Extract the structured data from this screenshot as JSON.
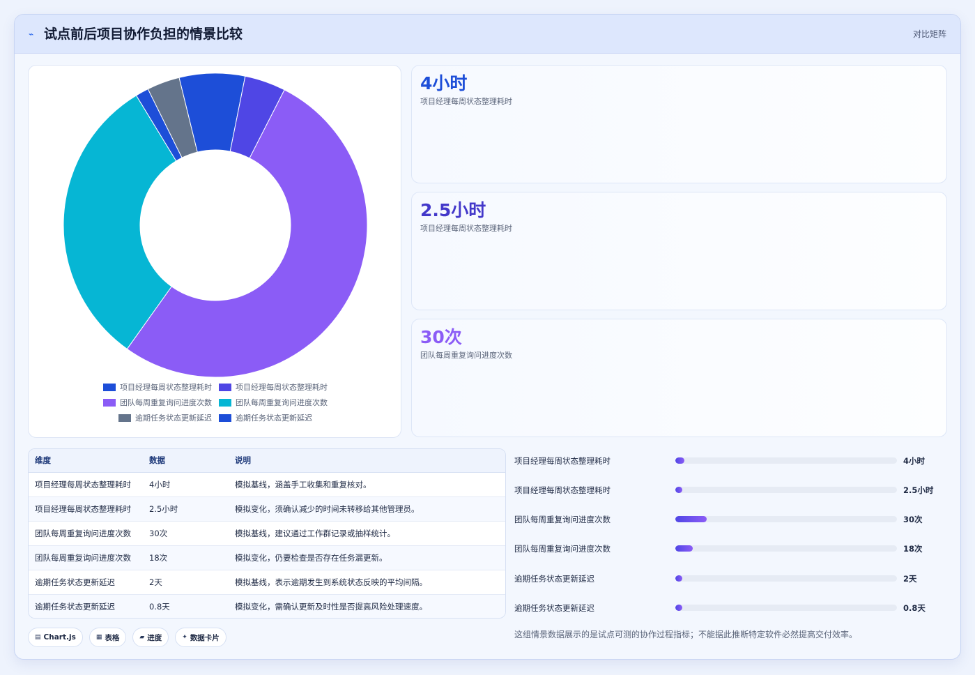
{
  "header": {
    "icon": "sparkline-icon",
    "title": "试点前后项目协作负担的情景比较",
    "mode_label": "对比矩阵"
  },
  "chart_data": {
    "type": "pie",
    "donut": true,
    "labels": [
      "项目经理每周状态整理耗时",
      "项目经理每周状态整理耗时",
      "团队每周重复询问进度次数",
      "团队每周重复询问进度次数",
      "逾期任务状态更新延迟",
      "逾期任务状态更新延迟"
    ],
    "values": [
      4,
      2.5,
      30,
      18,
      2,
      0.8
    ],
    "colors": [
      "#1d4ed8",
      "#4f46e5",
      "#8b5cf6",
      "#06b6d4",
      "#64748b",
      "#1d4ed8"
    ],
    "legend_position": "bottom"
  },
  "kpis": [
    {
      "value": "4小时",
      "label": "项目经理每周状态整理耗时",
      "color": "#1d4ed8"
    },
    {
      "value": "2.5小时",
      "label": "项目经理每周状态整理耗时",
      "color": "#4338ca"
    },
    {
      "value": "30次",
      "label": "团队每周重复询问进度次数",
      "color": "#8b5cf6"
    }
  ],
  "table": {
    "headers": [
      "维度",
      "数据",
      "说明"
    ],
    "rows": [
      [
        "项目经理每周状态整理耗时",
        "4小时",
        "模拟基线，涵盖手工收集和重复核对。"
      ],
      [
        "项目经理每周状态整理耗时",
        "2.5小时",
        "模拟变化，须确认减少的时间未转移给其他管理员。"
      ],
      [
        "团队每周重复询问进度次数",
        "30次",
        "模拟基线，建议通过工作群记录或抽样统计。"
      ],
      [
        "团队每周重复询问进度次数",
        "18次",
        "模拟变化，仍要检查是否存在任务漏更新。"
      ],
      [
        "逾期任务状态更新延迟",
        "2天",
        "模拟基线，表示逾期发生到系统状态反映的平均间隔。"
      ],
      [
        "逾期任务状态更新延迟",
        "0.8天",
        "模拟变化，需确认更新及时性是否提高风险处理速度。"
      ]
    ]
  },
  "progress": [
    {
      "label": "项目经理每周状态整理耗时",
      "value": "4小时",
      "fraction": 0.04
    },
    {
      "label": "项目经理每周状态整理耗时",
      "value": "2.5小时",
      "fraction": 0.025
    },
    {
      "label": "团队每周重复询问进度次数",
      "value": "30次",
      "fraction": 0.14
    },
    {
      "label": "团队每周重复询问进度次数",
      "value": "18次",
      "fraction": 0.08
    },
    {
      "label": "逾期任务状态更新延迟",
      "value": "2天",
      "fraction": 0.02
    },
    {
      "label": "逾期任务状态更新延迟",
      "value": "0.8天",
      "fraction": 0.008
    }
  ],
  "chips": [
    {
      "icon": "▤",
      "label": "Chart.js"
    },
    {
      "icon": "▦",
      "label": "表格"
    },
    {
      "icon": "▰",
      "label": "进度"
    },
    {
      "icon": "✦",
      "label": "数据卡片"
    }
  ],
  "note": "这组情景数据展示的是试点可测的协作过程指标；不能据此推断特定软件必然提高交付效率。"
}
